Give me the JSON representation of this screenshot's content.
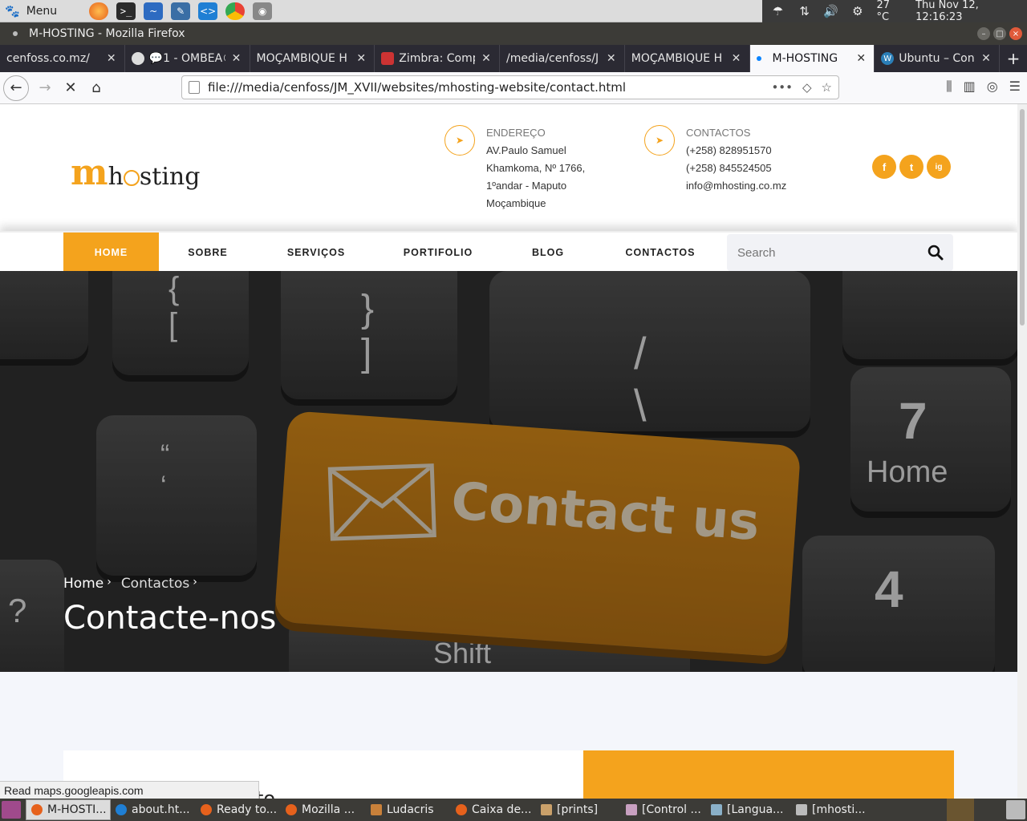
{
  "os_panel": {
    "menu_label": "Menu",
    "temperature": "27 °C",
    "datetime": "Thu Nov 12, 12:16:23"
  },
  "window": {
    "title": "M-HOSTING - Mozilla Firefox"
  },
  "tabs": [
    {
      "label": "cenfoss.co.mz/"
    },
    {
      "label": "💬1 - OMBEA©"
    },
    {
      "label": "MOÇAMBIQUE H"
    },
    {
      "label": "Zimbra: Comp"
    },
    {
      "label": "/media/cenfoss/J"
    },
    {
      "label": "MOÇAMBIQUE H"
    },
    {
      "label": "M-HOSTING"
    },
    {
      "label": "Ubuntu – Conf"
    }
  ],
  "url": "file:///media/cenfoss/JM_XVII/websites/mhosting-website/contact.html",
  "site": {
    "logo_m": "m",
    "logo_rest_a": "h",
    "logo_rest_b": "sting",
    "address": {
      "title": "ENDEREÇO",
      "lines": [
        "AV.Paulo Samuel",
        "Khamkoma, Nº 1766,",
        "1ºandar - Maputo",
        "Moçambique"
      ]
    },
    "contacts": {
      "title": "CONTACTOS",
      "lines": [
        "(+258) 828951570",
        "(+258) 845524505",
        "info@mhosting.co.mz"
      ]
    },
    "social": [
      "f",
      "t",
      "ig"
    ],
    "menu": [
      "HOME",
      "SOBRE",
      "SERVIÇOS",
      "PORTIFOLIO",
      "BLOG",
      "CONTACTOS"
    ],
    "search_placeholder": "Search",
    "hero": {
      "key_text": "Contact us",
      "key_home": "Home",
      "key_shift": "Shift",
      "key_seven": "7",
      "key_four": "4",
      "breadcrumb_home": "Home",
      "breadcrumb_current": "Contactos",
      "title": "Contacte-nos"
    },
    "card_title_fragment": "to"
  },
  "status_text": "Read maps.googleapis.com",
  "taskbar": [
    {
      "label": "M-HOSTI..."
    },
    {
      "label": "about.ht..."
    },
    {
      "label": "Ready to..."
    },
    {
      "label": "Mozilla ..."
    },
    {
      "label": "Ludacris"
    },
    {
      "label": "Caixa de..."
    },
    {
      "label": "[prints]"
    },
    {
      "label": "[Control ..."
    },
    {
      "label": "[Langua..."
    },
    {
      "label": "[mhosti..."
    }
  ]
}
